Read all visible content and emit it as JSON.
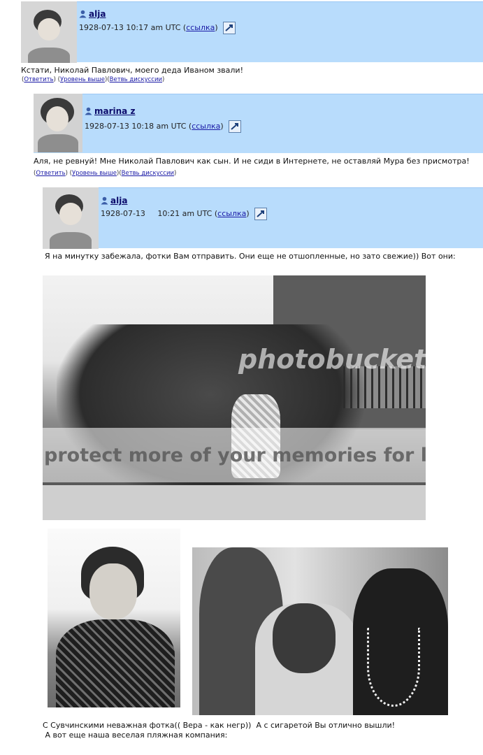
{
  "comments": [
    {
      "username": "alja",
      "timestamp": "1928-07-13 10:17 am UTC",
      "link_label": "ссылка",
      "text": "Кстати, Николай Павлович, моего деда Иваном звали!",
      "actions": {
        "reply": "Ответить",
        "up": "Уровень выше",
        "thread": "Ветвь дискуссии"
      }
    },
    {
      "username": "marina z",
      "timestamp": "1928-07-13  10:18 am UTC",
      "link_label": "ссылка",
      "text": "Аля, не ревнуй! Мне Николай Павлович как сын. И не сиди в Интернете, не оставляй Мура без присмотра!",
      "actions": {
        "reply": "Ответить",
        "up": "Уровень выше",
        "thread": "Ветвь дискуссии"
      }
    },
    {
      "username": "alja",
      "timestamp": "1928-07-13     10:21 am UTC",
      "link_label": "ссылка",
      "text": "Я на минутку забежала, фотки Вам отправить. Они еще не отшопленные, но зато свежие)) Вот они:",
      "caption_line1": "С Сувчинскими неважная фотка(( Вера - как негр))  А с сигаретой Вы отлично вышли!",
      "caption_line2": " А вот еще наша веселая пляжная компания:"
    }
  ],
  "photobucket": {
    "logo": "photobucket",
    "banner": "protect more of your memories for less!"
  }
}
